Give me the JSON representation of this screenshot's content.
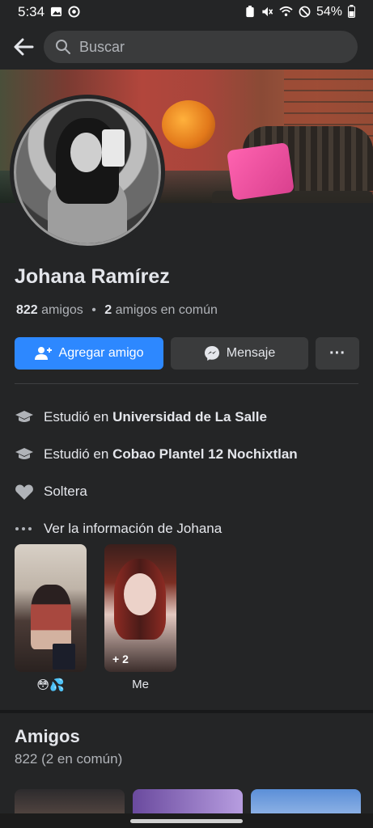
{
  "status_bar": {
    "time": "5:34",
    "battery": "54%",
    "left_icons": [
      "image-icon",
      "sync-icon"
    ],
    "right_icons": [
      "nfc-icon",
      "mute-icon",
      "wifi-icon",
      "dnd-icon",
      "battery-icon"
    ]
  },
  "header": {
    "search_placeholder": "Buscar"
  },
  "profile": {
    "name": "Johana Ramírez",
    "friends_count": "822",
    "friends_label": "amigos",
    "separator": "•",
    "mutual_count": "2",
    "mutual_label": "amigos en común"
  },
  "actions": {
    "add_friend": "Agregar amigo",
    "message": "Mensaje",
    "more": "···"
  },
  "info": {
    "study1_prefix": "Estudió en",
    "study1_school": "Universidad de La Salle",
    "study2_prefix": "Estudió en",
    "study2_school": "Cobao Plantel 12 Nochixtlan",
    "relationship": "Soltera",
    "see_info": "Ver la información de Johana"
  },
  "featured": [
    {
      "caption": "😳💦"
    },
    {
      "caption": "Me",
      "overlay": "+ 2"
    }
  ],
  "friends_section": {
    "title": "Amigos",
    "count": "822 (2 en común)"
  },
  "colors": {
    "background": "#242526",
    "primary_button": "#2d88ff",
    "secondary_button": "#3a3b3c",
    "text_primary": "#e4e6eb",
    "text_secondary": "#b0b3b8"
  }
}
